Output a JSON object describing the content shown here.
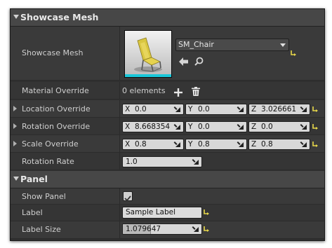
{
  "showcase_mesh": {
    "category_title": "Showcase Mesh",
    "mesh_label": "Showcase Mesh",
    "mesh_value": "SM_Chair",
    "material_label": "Material Override",
    "material_count": "0 elements",
    "location": {
      "label": "Location Override",
      "x_axis": "X",
      "x": "0.0",
      "y_axis": "Y",
      "y": "0.0",
      "z_axis": "Z",
      "z": "3.026661"
    },
    "rotation": {
      "label": "Rotation Override",
      "x_axis": "X",
      "x": "8.668354",
      "y_axis": "Y",
      "y": "0.0",
      "z_axis": "Z",
      "z": "0.0"
    },
    "scale": {
      "label": "Scale Override",
      "x_axis": "X",
      "x": "0.8",
      "y_axis": "Y",
      "y": "0.8",
      "z_axis": "Z",
      "z": "0.8"
    },
    "rotation_rate": {
      "label": "Rotation Rate",
      "value": "1.0"
    }
  },
  "panel_section": {
    "category_title": "Panel",
    "show_panel": {
      "label": "Show Panel",
      "checked": true
    },
    "label_field": {
      "label": "Label",
      "value": "Sample Label"
    },
    "label_size": {
      "label": "Label Size",
      "value": "1.079647",
      "fill_fraction": 0.35
    }
  },
  "colors": {
    "reset_arrow": "#e8d84a",
    "thumbnail_accent": "#18c7d9"
  }
}
